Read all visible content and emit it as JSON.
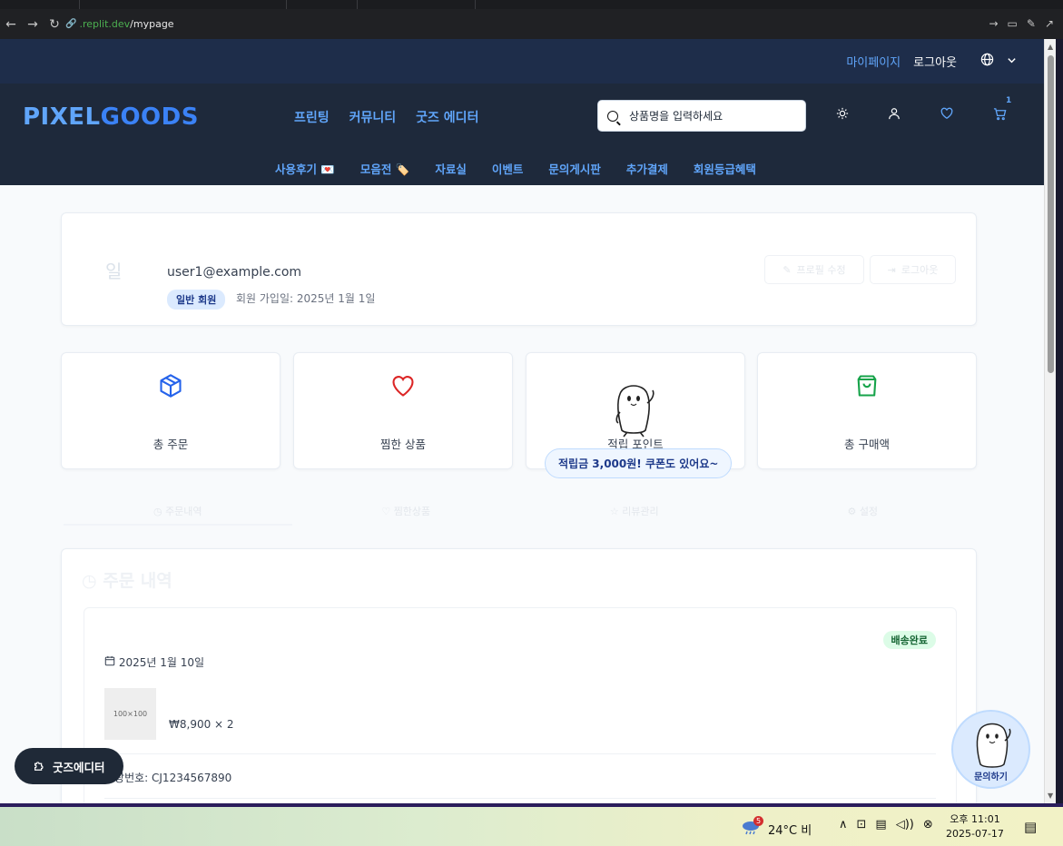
{
  "browser": {
    "url_host": ".replit.dev",
    "url_path": "/mypage"
  },
  "topbar": {
    "mypage": "마이페이지",
    "logout": "로그아웃"
  },
  "header": {
    "logo_part1": "PIXEL",
    "logo_part2": "GOODS",
    "nav": [
      "프린팅",
      "커뮤니티",
      "굿즈 에디터"
    ],
    "search_placeholder": "상품명을 입력하세요",
    "cart_count": "1",
    "subnav": [
      "사용후기 💌",
      "모음전 🏷️",
      "자료실",
      "이벤트",
      "문의게시판",
      "추가결제",
      "회원등급혜택"
    ]
  },
  "profile": {
    "avatar_text": "일",
    "email": "user1@example.com",
    "member_badge": "일반 회원",
    "joined": "회원 가입일: 2025년 1월 1일",
    "edit_button": "프로필 수정",
    "logout_button": "로그아웃"
  },
  "stats": [
    {
      "label": "총 주문",
      "icon": "box-icon",
      "color": "#2563eb"
    },
    {
      "label": "찜한 상품",
      "icon": "heart-icon",
      "color": "#dc2626"
    },
    {
      "label": "적립 포인트",
      "icon": "mascot",
      "color": "#6b7280"
    },
    {
      "label": "총 구매액",
      "icon": "shopping-bag-icon",
      "color": "#16a34a"
    }
  ],
  "bubble_text": "적립금 3,000원! 쿠폰도 있어요~",
  "tabs": [
    "주문내역",
    "찜한상품",
    "리뷰관리",
    "설정"
  ],
  "orders": {
    "title": "주문 내역",
    "status": "배송완료",
    "date": "2025년 1월 10일",
    "thumb_text": "100×100",
    "price": "₩8,900 × 2",
    "tracking": "송장번호: CJ1234567890"
  },
  "floating": {
    "goods_editor": "굿즈에디터",
    "inquiry": "문의하기"
  },
  "taskbar": {
    "weather_badge": "5",
    "weather": "24°C  비",
    "time": "오후 11:01",
    "date": "2025-07-17"
  }
}
